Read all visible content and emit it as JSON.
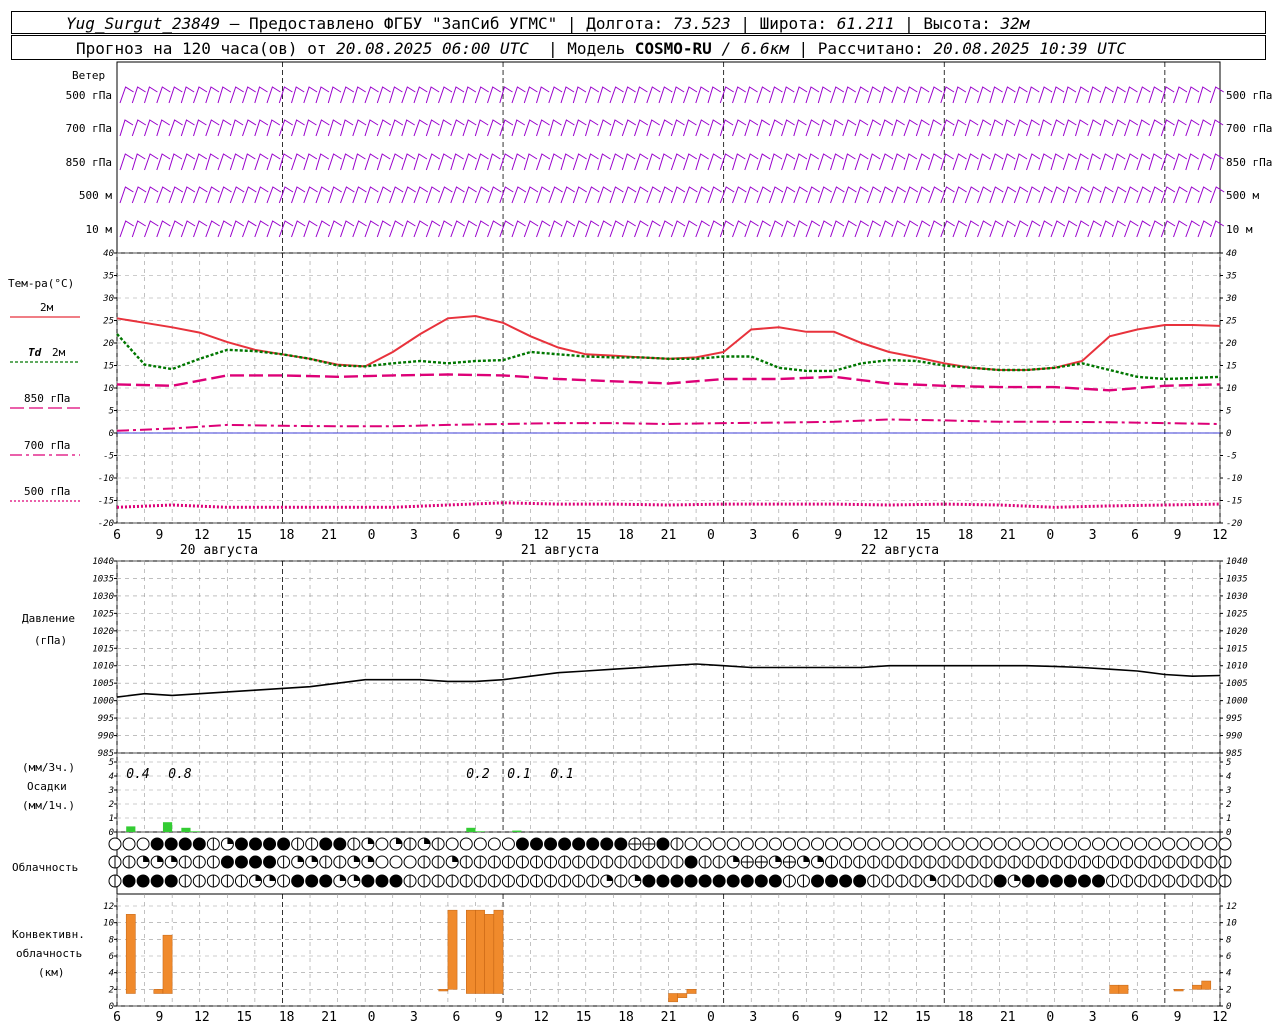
{
  "header": {
    "station": "Yug_Surgut_23849",
    "provider": "— Предоставлено ФГБУ \"ЗапСиб УГМС\"",
    "lon_label": "Долгота:",
    "lon_value": "73.523",
    "lat_label": "Широта:",
    "lat_value": "61.211",
    "alt_label": "Высота:",
    "alt_value": "32м",
    "forecast_prefix": "Прогноз на 120 часа(ов) от",
    "forecast_start": "20.08.2025 06:00 UTC",
    "model_label": "Модель",
    "model_name": "COSMO-RU",
    "model_res": "/ 6.6км",
    "computed_label": "Рассчитано:",
    "computed_value": "20.08.2025 10:39 UTC"
  },
  "panels": {
    "wind": {
      "title": "Ветер",
      "levels": [
        "500 гПа",
        "700 гПа",
        "850 гПа",
        "500 м",
        "10 м"
      ],
      "color": "#9900cc"
    },
    "temperature": {
      "title": "Тем-ра(°C)",
      "legend": [
        {
          "label": "2м",
          "color": "#e8323c",
          "dash": "solid"
        },
        {
          "label": "Td 2м",
          "color": "#007700",
          "dash": "dot"
        },
        {
          "label": "850 гПа",
          "color": "#dd0077",
          "dash": "long"
        },
        {
          "label": "700 гПа",
          "color": "#dd0077",
          "dash": "dashdot"
        },
        {
          "label": "500 гПа",
          "color": "#dd0077",
          "dash": "dotted"
        }
      ],
      "yticks": [
        "40",
        "35",
        "30",
        "25",
        "20",
        "15",
        "10",
        "5",
        "0",
        "-5",
        "-10",
        "-15",
        "-20"
      ]
    },
    "pressure": {
      "title": "Давление",
      "unit": "(гПа)",
      "yticks": [
        "1040",
        "1035",
        "1030",
        "1025",
        "1020",
        "1015",
        "1010",
        "1005",
        "1000",
        "995",
        "990",
        "985"
      ]
    },
    "precip": {
      "title": "Осадки",
      "unit_top": "(мм/3ч.)",
      "unit_bottom": "(мм/1ч.)",
      "yticks": [
        "5",
        "4",
        "3",
        "2",
        "1",
        "0"
      ],
      "annotations": [
        "0.4",
        "0.8",
        "0.2",
        "0.1",
        "0.1"
      ]
    },
    "cloud": {
      "title": "Облачность"
    },
    "convective": {
      "title_lines": [
        "Конвективн.",
        "облачность",
        "(км)"
      ],
      "yticks": [
        "12",
        "10",
        "8",
        "6",
        "4",
        "2",
        "0"
      ]
    }
  },
  "x_axis": {
    "tick_labels": [
      "6",
      "9",
      "12",
      "15",
      "18",
      "21",
      "0",
      "3",
      "6",
      "9",
      "12",
      "15",
      "18",
      "21",
      "0",
      "3",
      "6",
      "9",
      "12",
      "15",
      "18",
      "21",
      "0",
      "3",
      "6",
      "9",
      "12"
    ],
    "days": [
      "20 августа",
      "21 августа",
      "22 августа"
    ]
  },
  "chart_data": [
    {
      "type": "line",
      "title": "Тем-ра(°C)",
      "x_unit": "hours since 20.08.2025 06:00 UTC",
      "ylim": [
        -20,
        40
      ],
      "series": [
        {
          "name": "2м",
          "x": [
            0,
            3,
            6,
            9,
            12,
            15,
            18,
            21,
            24,
            27,
            30,
            33,
            36,
            39,
            42,
            45,
            48,
            51,
            54,
            57,
            60,
            63,
            66,
            69,
            72,
            75,
            78,
            81,
            84,
            87,
            90,
            93,
            96,
            99,
            102,
            105,
            108,
            111,
            114,
            117,
            120
          ],
          "values": [
            25.5,
            24.5,
            23.5,
            22.3,
            20.2,
            18.5,
            17.5,
            16.5,
            15.2,
            14.8,
            18,
            22,
            25.5,
            26,
            24.5,
            21.5,
            19,
            17.5,
            17.2,
            16.8,
            16.5,
            16.8,
            18,
            23,
            23.5,
            22.5,
            22.5,
            20,
            18,
            16.8,
            15.5,
            14.5,
            14,
            14,
            14.5,
            16,
            21.5,
            23,
            24,
            24,
            23.8
          ]
        },
        {
          "name": "Td 2м",
          "x": [
            0,
            3,
            6,
            9,
            12,
            15,
            18,
            21,
            24,
            27,
            30,
            33,
            36,
            39,
            42,
            45,
            48,
            51,
            54,
            57,
            60,
            63,
            66,
            69,
            72,
            75,
            78,
            81,
            84,
            87,
            90,
            93,
            96,
            99,
            102,
            105,
            108,
            111,
            114,
            117,
            120
          ],
          "values": [
            22,
            15.2,
            14.2,
            16.5,
            18.5,
            18.2,
            17.5,
            16.5,
            15,
            14.8,
            15.5,
            16,
            15.5,
            16,
            16.2,
            18,
            17.5,
            17,
            16.8,
            16.8,
            16.5,
            16.5,
            17,
            17,
            14.5,
            13.8,
            13.8,
            15.5,
            16.2,
            16,
            15,
            14.5,
            14,
            14,
            14.5,
            15.5,
            14,
            12.5,
            12,
            12.2,
            12.5
          ]
        },
        {
          "name": "850 гПа",
          "x": [
            0,
            6,
            12,
            18,
            24,
            30,
            36,
            42,
            48,
            54,
            60,
            66,
            72,
            78,
            84,
            90,
            96,
            102,
            108,
            114,
            120
          ],
          "values": [
            10.8,
            10.5,
            12.8,
            12.8,
            12.5,
            12.8,
            13,
            12.8,
            12,
            11.5,
            11,
            12,
            12,
            12.5,
            11,
            10.5,
            10.2,
            10.2,
            9.5,
            10.5,
            10.8
          ]
        },
        {
          "name": "700 гПа",
          "x": [
            0,
            6,
            12,
            18,
            24,
            30,
            36,
            42,
            48,
            54,
            60,
            66,
            72,
            78,
            84,
            90,
            96,
            102,
            108,
            114,
            120
          ],
          "values": [
            0.5,
            1,
            1.8,
            1.6,
            1.5,
            1.5,
            1.8,
            2,
            2.2,
            2.2,
            2,
            2.2,
            2.3,
            2.5,
            3,
            2.8,
            2.5,
            2.5,
            2.4,
            2.2,
            2
          ]
        },
        {
          "name": "500 гПа",
          "x": [
            0,
            6,
            12,
            18,
            24,
            30,
            36,
            42,
            48,
            54,
            60,
            66,
            72,
            78,
            84,
            90,
            96,
            102,
            108,
            114,
            120
          ],
          "values": [
            -16.5,
            -16,
            -16.5,
            -16.5,
            -16.5,
            -16.5,
            -16,
            -15.5,
            -15.8,
            -15.8,
            -16,
            -15.8,
            -15.8,
            -15.8,
            -16,
            -15.8,
            -16,
            -16.5,
            -16.2,
            -16,
            -15.8
          ]
        }
      ]
    },
    {
      "type": "line",
      "title": "Давление",
      "ylabel": "(гПа)",
      "x_unit": "hours since 20.08.2025 06:00 UTC",
      "ylim": [
        985,
        1040
      ],
      "series": [
        {
          "name": "",
          "x": [
            0,
            3,
            6,
            9,
            12,
            15,
            18,
            21,
            24,
            27,
            30,
            33,
            36,
            39,
            42,
            45,
            48,
            51,
            54,
            57,
            60,
            63,
            66,
            69,
            72,
            75,
            78,
            81,
            84,
            87,
            90,
            93,
            96,
            99,
            102,
            105,
            108,
            111,
            114,
            117,
            120
          ],
          "values": [
            1001,
            1002,
            1001.5,
            1002,
            1002.5,
            1003,
            1003.5,
            1004,
            1005,
            1006,
            1006,
            1006,
            1005.5,
            1005.5,
            1006,
            1007,
            1008,
            1008.5,
            1009,
            1009.5,
            1010,
            1010.5,
            1010,
            1009.5,
            1009.5,
            1009.5,
            1009.5,
            1009.5,
            1010,
            1010,
            1010,
            1010,
            1010,
            1010,
            1009.8,
            1009.5,
            1009,
            1008.5,
            1007.5,
            1007,
            1007.2
          ]
        }
      ]
    },
    {
      "type": "bar",
      "title": "Осадки",
      "ylabel": "(мм/1ч.)",
      "x_unit": "hours since 20.08.2025 06:00 UTC",
      "ylim": [
        0,
        5
      ],
      "x": [
        1.5,
        4.5,
        5.5,
        7.5,
        8.5,
        9.5,
        38.5,
        39.5,
        43.5
      ],
      "values": [
        0.4,
        0.0,
        0.7,
        0.3,
        0.05,
        0.0,
        0.3,
        0.05,
        0.1
      ]
    },
    {
      "type": "bar",
      "title": "Конвективн. облачность (км)",
      "x_unit": "hours since 20.08.2025 06:00 UTC",
      "ylim": [
        0,
        13
      ],
      "bars": [
        {
          "x": 1.5,
          "bottom": 1.5,
          "top": 11
        },
        {
          "x": 4.5,
          "bottom": 1.5,
          "top": 2
        },
        {
          "x": 5.5,
          "bottom": 1.5,
          "top": 8.5
        },
        {
          "x": 35.5,
          "bottom": 1.8,
          "top": 2
        },
        {
          "x": 36.5,
          "bottom": 2,
          "top": 11.5
        },
        {
          "x": 38.5,
          "bottom": 1.5,
          "top": 11.5
        },
        {
          "x": 39.5,
          "bottom": 1.5,
          "top": 11.5
        },
        {
          "x": 40.5,
          "bottom": 1.5,
          "top": 11
        },
        {
          "x": 41.5,
          "bottom": 1.5,
          "top": 11.5
        },
        {
          "x": 60.5,
          "bottom": 0.5,
          "top": 1.5
        },
        {
          "x": 61.5,
          "bottom": 1,
          "top": 1.5
        },
        {
          "x": 62.5,
          "bottom": 1.5,
          "top": 2
        },
        {
          "x": 108.5,
          "bottom": 1.5,
          "top": 2.5
        },
        {
          "x": 109.5,
          "bottom": 1.5,
          "top": 2.5
        },
        {
          "x": 115.5,
          "bottom": 1.8,
          "top": 2
        },
        {
          "x": 117.5,
          "bottom": 2,
          "top": 2.5
        },
        {
          "x": 118.5,
          "bottom": 2,
          "top": 3
        }
      ]
    }
  ],
  "colors": {
    "grid": "#999999",
    "wind": "#9900cc",
    "t2m": "#e8323c",
    "td2m": "#007700",
    "upper": "#dd0077",
    "zero_line": "#0000cc",
    "precip": "#33cc33",
    "convective": "#f08a2c"
  },
  "cloud_rows": [
    "oooffffhqffffhhffhqoqhqhoooooffffffffeefhoooooooooooooooooooooooooooooooooooooooooooooqff",
    "hhqqqhhhffffhqqhhqqooohhqhhhhhhhhhhhhhhhhfhhqeeqeqqhhhhhhhhhhhhhhhhhhhhhhhhhhhhhhhhhhhhhhhf",
    "hffffhhhhhqqhfffqqfffhhhhhhhhhhhhhhqhqffffffffffhhffffhhhhqhhhhfqffffffhhhhhhhhhhhhhhhhhhhh"
  ]
}
